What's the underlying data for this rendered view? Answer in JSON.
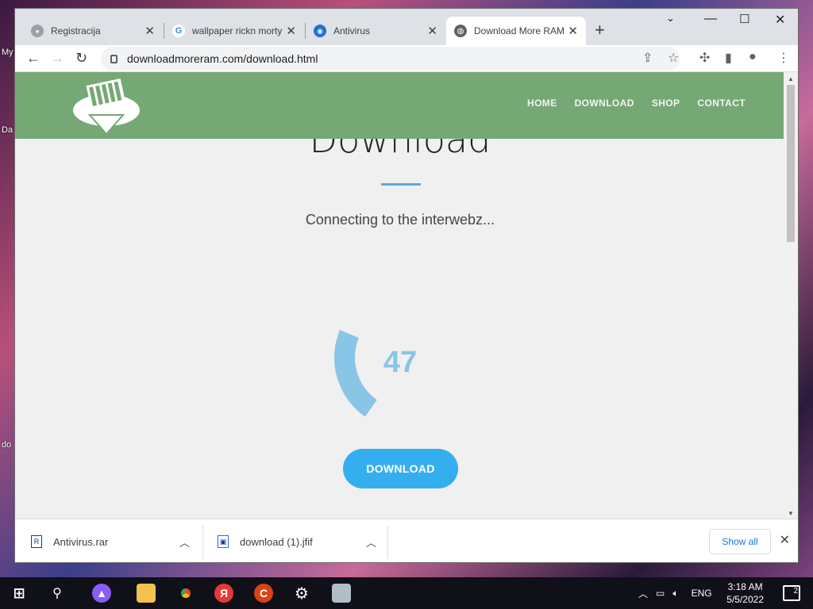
{
  "desktop": {
    "labels": [
      "My",
      "Da",
      "do"
    ]
  },
  "browser": {
    "tabs": [
      {
        "title": "Registracija",
        "active": false
      },
      {
        "title": "wallpaper rickn morty",
        "active": false
      },
      {
        "title": "Antivirus",
        "active": false
      },
      {
        "title": "Download More RAM",
        "active": true
      }
    ],
    "new_tab_label": "+",
    "url": "downloadmoreram.com/download.html"
  },
  "site": {
    "nav": [
      "HOME",
      "DOWNLOAD",
      "SHOP",
      "CONTACT"
    ],
    "heading": "Download",
    "status": "Connecting to the interwebz...",
    "progress": 47,
    "progress_text": "47",
    "button": "DOWNLOAD",
    "accent": "#35aef0",
    "header_color": "#75a874"
  },
  "downloads": {
    "items": [
      {
        "name": "Antivirus.rar",
        "icon": "rar-file-icon"
      },
      {
        "name": "download (1).jfif",
        "icon": "image-file-icon"
      }
    ],
    "show_all": "Show all"
  },
  "taskbar": {
    "language": "ENG",
    "time": "3:18 AM",
    "date": "5/5/2022",
    "notification_count": "2"
  }
}
